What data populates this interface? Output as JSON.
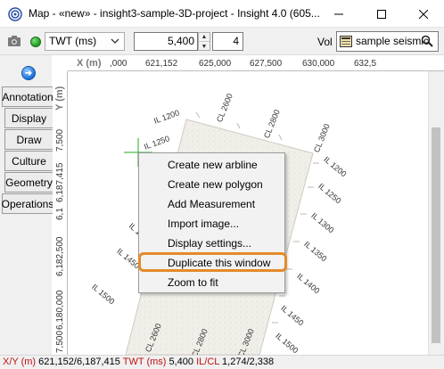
{
  "window": {
    "title": "Map - «new» - insight3-sample-3D-project - Insight 4.0 (605..."
  },
  "toolbar": {
    "domain_value": "TWT (ms)",
    "time_value": "5,400",
    "step_value": "4",
    "vol_label": "Vol",
    "volume_value": "sample seismic",
    "status_color": "#1b9a1b"
  },
  "left_panel": {
    "tabs": [
      "Annotation",
      "Display",
      "Draw",
      "Culture",
      "Geometry",
      "Operations"
    ]
  },
  "map": {
    "x_axis_title": "X (m)",
    "y_axis_title": "Y (m)",
    "x_ticks": [
      ",000",
      "621,152",
      "625,000",
      "627,500",
      "630,000",
      "632,5"
    ],
    "y_ticks": [
      "7,500",
      "6,187,415",
      "6,1",
      "6,182,500",
      "6,180,000",
      "7,500"
    ],
    "il_labels": [
      "IL 1200",
      "IL 1250",
      "IL 140",
      "IL 1450",
      "IL 1500",
      "IL 1200",
      "IL 1250",
      "IL 1300",
      "IL 1350",
      "IL 1400",
      "IL 1450",
      "IL 1500"
    ],
    "cl_labels": [
      "CL 2600",
      "CL 2800",
      "CL 3000",
      "CL 2600",
      "CL 2800",
      "CL 3000"
    ],
    "crosshair_color": "#22aa22"
  },
  "context_menu": {
    "items": [
      "Create new arbline",
      "Create new polygon",
      "Add Measurement",
      "Import image...",
      "Display settings...",
      "Duplicate this window",
      "Zoom to fit"
    ],
    "highlight_color": "#e48a2a"
  },
  "status": {
    "xy_label": "X/Y (m)",
    "xy_value": "621,152/6,187,415",
    "twt_label": "TWT (ms)",
    "twt_value": "5,400",
    "ilcl_label": "IL/CL",
    "ilcl_value": "1,274/2,338"
  }
}
